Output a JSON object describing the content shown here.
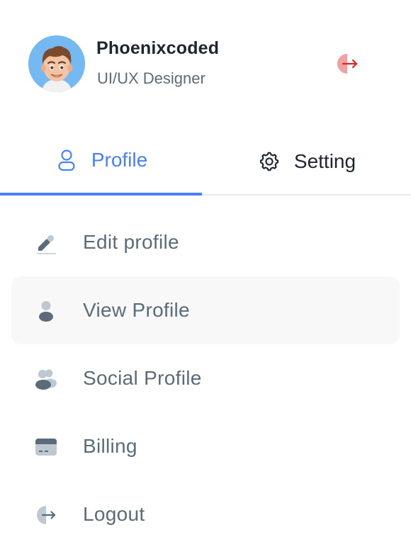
{
  "user": {
    "name": "Phoenixcoded",
    "role": "UI/UX Designer",
    "avatar_icon": "memoji-avatar"
  },
  "header": {
    "logout_icon": "logout-arrow-icon"
  },
  "tabs": [
    {
      "label": "Profile",
      "icon": "user-icon",
      "active": true
    },
    {
      "label": "Setting",
      "icon": "gear-icon",
      "active": false
    }
  ],
  "menu": [
    {
      "label": "Edit profile",
      "icon": "edit-icon"
    },
    {
      "label": "View Profile",
      "icon": "user-icon",
      "highlighted": true
    },
    {
      "label": "Social Profile",
      "icon": "users-icon"
    },
    {
      "label": "Billing",
      "icon": "card-icon"
    },
    {
      "label": "Logout",
      "icon": "logout-icon"
    }
  ],
  "colors": {
    "accent": "#4680ff",
    "text_primary": "#1d2630",
    "text_secondary": "#5b6b79",
    "danger": "#dc2626",
    "avatar_bg": "#74b9f2",
    "hover_bg": "#f8f8f8"
  }
}
